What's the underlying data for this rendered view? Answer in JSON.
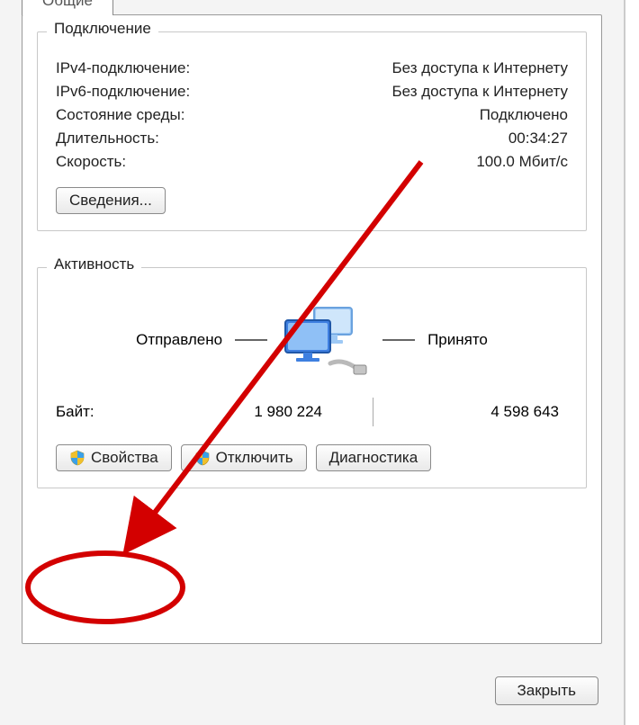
{
  "tab": {
    "label": "Общие"
  },
  "connection": {
    "heading": "Подключение",
    "rows": [
      {
        "label": "IPv4-подключение:",
        "value": "Без доступа к Интернету"
      },
      {
        "label": "IPv6-подключение:",
        "value": "Без доступа к Интернету"
      },
      {
        "label": "Состояние среды:",
        "value": "Подключено"
      },
      {
        "label": "Длительность:",
        "value": "00:34:27"
      },
      {
        "label": "Скорость:",
        "value": "100.0 Мбит/с"
      }
    ],
    "details_button": "Сведения..."
  },
  "activity": {
    "heading": "Активность",
    "sent_label": "Отправлено",
    "received_label": "Принято",
    "bytes_label": "Байт:",
    "bytes_sent": "1 980 224",
    "bytes_received": "4 598 643",
    "buttons": {
      "properties": "Свойства",
      "disable": "Отключить",
      "diagnose": "Диагностика"
    }
  },
  "close_button": "Закрыть"
}
